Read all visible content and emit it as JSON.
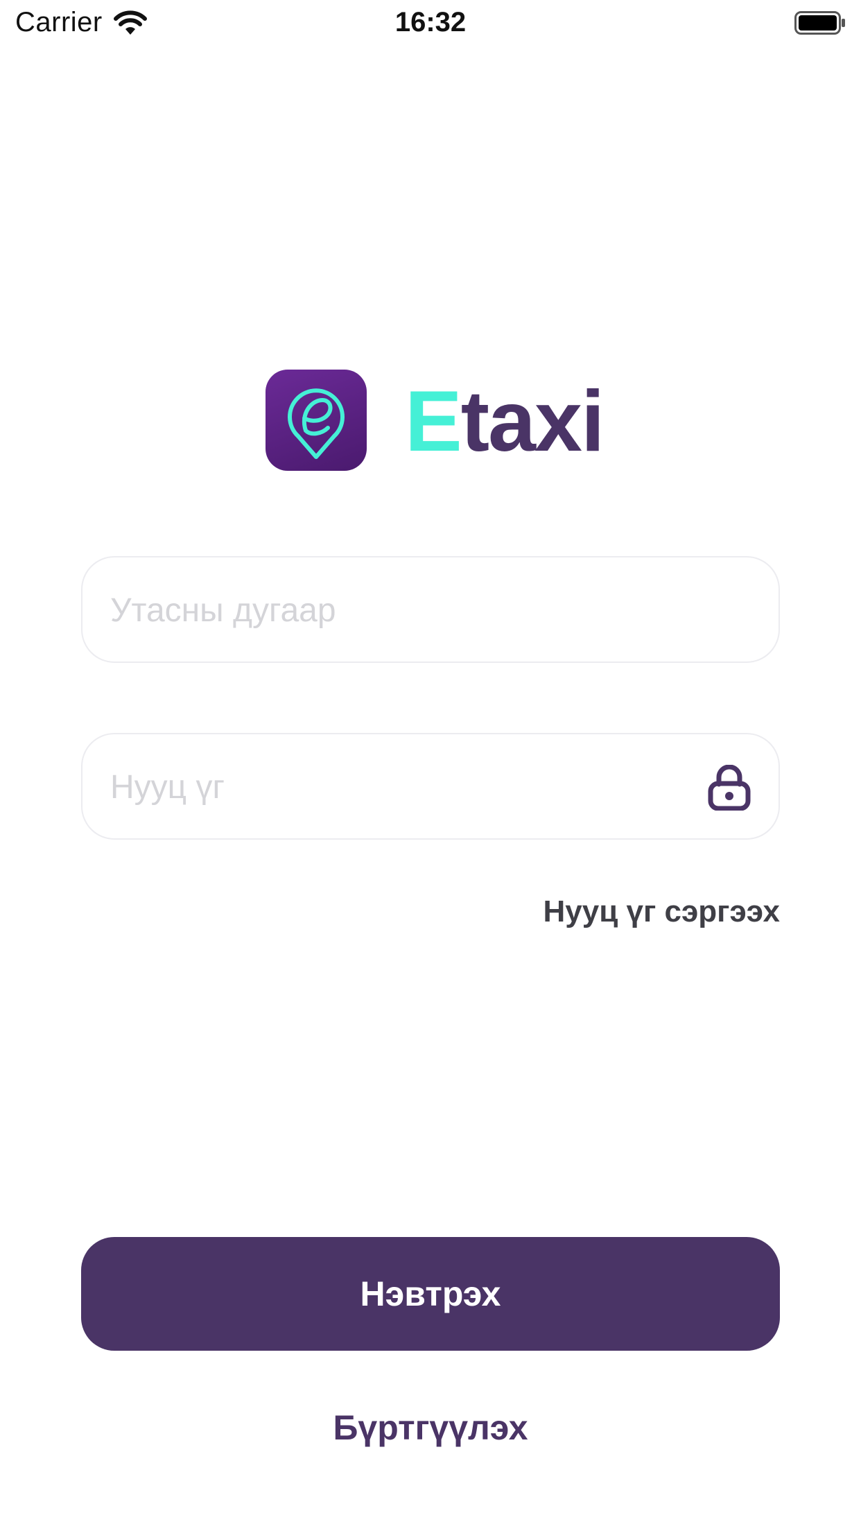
{
  "status_bar": {
    "carrier": "Carrier",
    "time": "16:32"
  },
  "brand": {
    "accent_letter": "E",
    "rest": "taxi",
    "accent_color": "#45f0d6",
    "primary_color": "#4a3466",
    "icon": "map-pin-e-icon"
  },
  "login_form": {
    "phone_placeholder": "Утасны дугаар",
    "password_placeholder": "Нууц үг",
    "password_icon": "lock-icon",
    "forgot_password_label": "Нууц үг сэргээх",
    "login_label": "Нэвтрэх",
    "register_label": "Бүртгүүлэх"
  }
}
